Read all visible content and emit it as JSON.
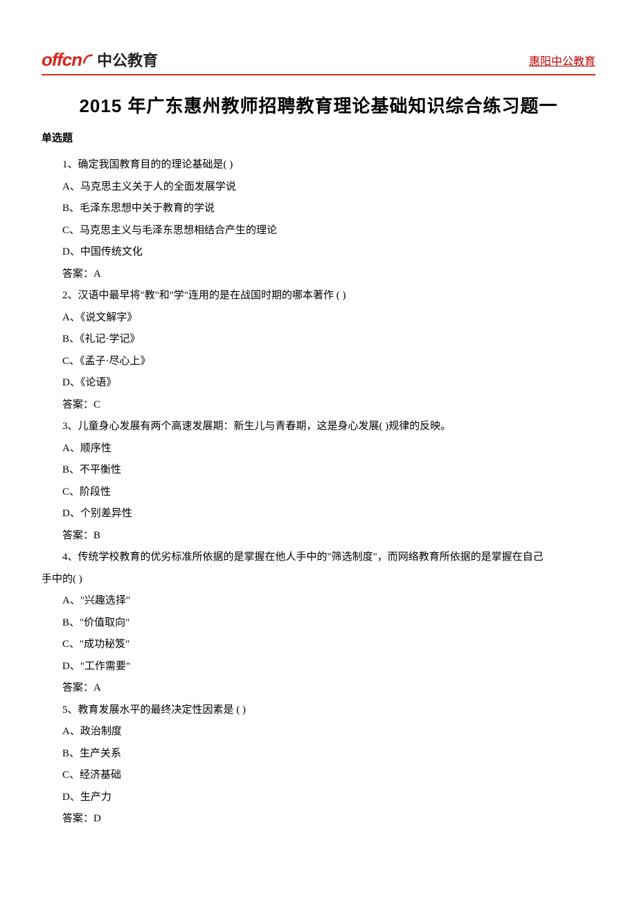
{
  "header": {
    "logo_en": "offcn",
    "logo_cn": "中公教育",
    "right_link": "惠阳中公教育"
  },
  "title": "2015 年广东惠州教师招聘教育理论基础知识综合练习题一",
  "section_label": "单选题",
  "questions": [
    {
      "stem": "1、确定我国教育目的的理论基础是( )",
      "options": [
        "A、马克思主义关于人的全面发展学说",
        "B、毛泽东思想中关于教育的学说",
        "C、马克思主义与毛泽东思想相结合产生的理论",
        "D、中国传统文化"
      ],
      "answer": "答案：A"
    },
    {
      "stem": "2、汉语中最早将\"教\"和\"学\"连用的是在战国时期的哪本著作 ( )",
      "options": [
        "A、《说文解字》",
        "B、《礼记·学记》",
        "C、《孟子·尽心上》",
        "D、《论语》"
      ],
      "answer": "答案：C"
    },
    {
      "stem": "3、儿童身心发展有两个高速发展期：新生儿与青春期，这是身心发展( )规律的反映。",
      "options": [
        "A、顺序性",
        "B、不平衡性",
        "C、阶段性",
        "D、个别差异性"
      ],
      "answer": "答案：B"
    },
    {
      "stem_part1": "4、传统学校教育的优劣标准所依据的是掌握在他人手中的\"筛选制度\"，而网络教育所依据的是掌握在自己",
      "stem_part2": "手中的( )",
      "options": [
        "A、\"兴趣选择\"",
        "B、\"价值取向\"",
        "C、\"成功秘笈\"",
        "D、\"工作需要\""
      ],
      "answer": "答案：A"
    },
    {
      "stem": "5、教育发展水平的最终决定性因素是 ( )",
      "options": [
        "A、政治制度",
        "B、生产关系",
        "C、经济基础",
        "D、生产力"
      ],
      "answer": "答案：D"
    }
  ]
}
